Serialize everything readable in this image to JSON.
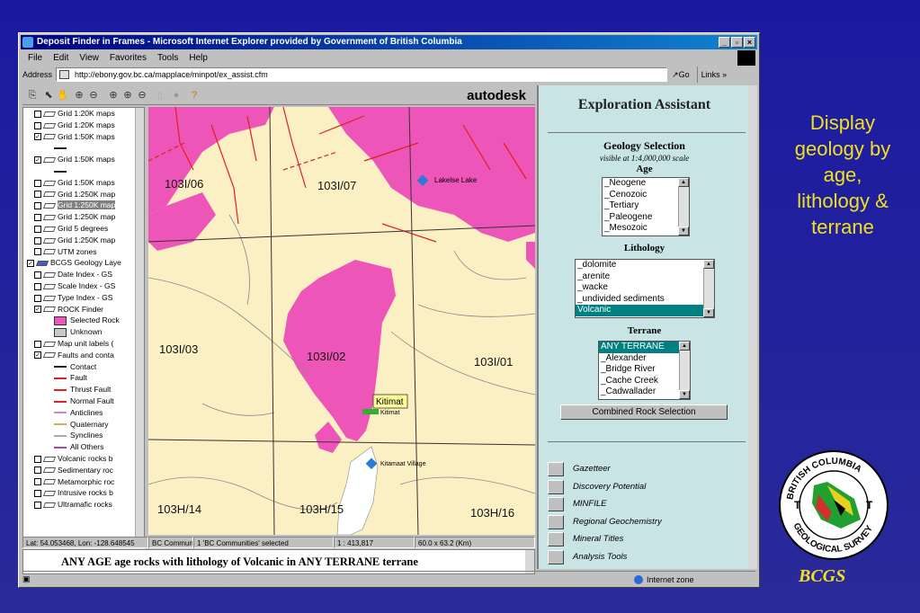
{
  "window": {
    "title": "Deposit Finder in Frames - Microsoft Internet Explorer provided by Government of British Columbia",
    "controls": [
      "_",
      "▫",
      "×"
    ]
  },
  "menu": [
    "File",
    "Edit",
    "View",
    "Favorites",
    "Tools",
    "Help"
  ],
  "address": {
    "label": "Address",
    "url": "http://ebony.gov.bc.ca/mapplace/minpot/ex_assist.cfm",
    "go": "Go",
    "links": "Links »"
  },
  "map_toolbar": {
    "brand": "autodesk"
  },
  "layers": [
    {
      "label": "Grid 1:20K maps",
      "check": "",
      "type": "layer"
    },
    {
      "label": "Grid 1:20K maps",
      "check": "",
      "type": "layer"
    },
    {
      "label": "Grid 1:50K maps",
      "check": "✓",
      "type": "layer"
    },
    {
      "label": "",
      "check": "",
      "type": "blank"
    },
    {
      "label": "Grid 1:50K maps",
      "check": "✓",
      "type": "layer"
    },
    {
      "label": "",
      "check": "",
      "type": "blank"
    },
    {
      "label": "Grid 1:50K maps",
      "check": "",
      "type": "layer"
    },
    {
      "label": "Grid 1:250K map",
      "check": "",
      "type": "layer"
    },
    {
      "label": "Grid 1:250K map",
      "check": "",
      "type": "layer",
      "highlight": true
    },
    {
      "label": "Grid 1:250K map",
      "check": "",
      "type": "layer"
    },
    {
      "label": "Grid 5 degrees",
      "check": "",
      "type": "layer"
    },
    {
      "label": "Grid 1:250K map",
      "check": "",
      "type": "layer"
    },
    {
      "label": "UTM zones",
      "check": "",
      "type": "layer"
    },
    {
      "label": "BCGS Geology Laye",
      "check": "✓",
      "type": "group"
    },
    {
      "label": "Date Index - GS",
      "check": "",
      "type": "layer"
    },
    {
      "label": "Scale Index - GS",
      "check": "",
      "type": "layer"
    },
    {
      "label": "Type Index - GS",
      "check": "",
      "type": "layer"
    },
    {
      "label": "ROCK Finder",
      "check": "✓",
      "type": "layer"
    },
    {
      "label": "Selected Rock",
      "type": "swatch",
      "color": "#ee55b8"
    },
    {
      "label": "Unknown",
      "type": "swatch",
      "color": "#c8c8c8"
    },
    {
      "label": "Map unit labels (",
      "check": "",
      "type": "layer"
    },
    {
      "label": "Faults and conta",
      "check": "✓",
      "type": "layer"
    },
    {
      "label": "Contact",
      "type": "line",
      "color": "#222222"
    },
    {
      "label": "Fault",
      "type": "line",
      "color": "#dd2222"
    },
    {
      "label": "Thrust Fault",
      "type": "line",
      "color": "#dd2222"
    },
    {
      "label": "Normal Fault",
      "type": "line",
      "color": "#dd2222"
    },
    {
      "label": "Anticlines",
      "type": "line",
      "color": "#cc88cc"
    },
    {
      "label": "Quaternary",
      "type": "line",
      "color": "#c8b060"
    },
    {
      "label": "Synclines",
      "type": "line",
      "color": "#aaaaaa"
    },
    {
      "label": "All Others",
      "type": "line",
      "color": "#aa44aa"
    },
    {
      "label": "Volcanic rocks b",
      "check": "",
      "type": "layer"
    },
    {
      "label": "Sedimentary roc",
      "check": "",
      "type": "layer"
    },
    {
      "label": "Metamorphic roc",
      "check": "",
      "type": "layer"
    },
    {
      "label": "Intrusive rocks b",
      "check": "",
      "type": "layer"
    },
    {
      "label": "Ultramafic rocks",
      "check": "",
      "type": "layer"
    }
  ],
  "map": {
    "tiles": [
      "103I/06",
      "103I/07",
      "103I/03",
      "103I/02",
      "103I/01",
      "103H/14",
      "103H/15",
      "103H/16"
    ],
    "places": [
      "Lakelse Lake",
      "Kitimat",
      "Kitimat",
      "Kitamaat Village"
    ]
  },
  "status": {
    "coords": "Lat: 54.053468, Lon: -128.648545",
    "layer": "BC Commun",
    "selected": "1 'BC Communities' selected",
    "scale": "1 : 413,817",
    "extent": "60.0 x 63.2 (Km)"
  },
  "result_text": "ANY AGE age rocks with lithology of Volcanic in ANY TERRANE terrane",
  "assistant": {
    "title": "Exploration Assistant",
    "geology_title": "Geology Selection",
    "geology_sub": "visible at 1:4,000,000 scale",
    "age_label": "Age",
    "age_options": [
      "_Neogene",
      "_Cenozoic",
      "_Tertiary",
      "_Paleogene",
      "_Mesozoic"
    ],
    "lithology_label": "Lithology",
    "lithology_options": [
      "_dolomite",
      "_arenite",
      "_wacke",
      "_undivided sediments",
      "Volcanic"
    ],
    "lithology_selected": 4,
    "terrane_label": "Terrane",
    "terrane_options": [
      "ANY TERRANE",
      "_Alexander",
      "_Bridge River",
      "_Cache Creek",
      "_Cadwallader"
    ],
    "terrane_selected": 0,
    "combined_button": "Combined Rock Selection",
    "nav": [
      "Gazetteer",
      "Discovery Potential",
      "MINFILE",
      "Regional Geochemistry",
      "Mineral Titles",
      "Analysis Tools"
    ]
  },
  "statusbar": {
    "zone": "Internet zone"
  },
  "slide": {
    "caption": [
      "Display",
      "geology by",
      "age,",
      "lithology &",
      "terrane"
    ],
    "logo_text": [
      "BRITISH COLUMBIA",
      "GEOLOGICAL SURVEY"
    ],
    "footer": "BCGS"
  },
  "colors": {
    "accent_yellow": "#f0e020",
    "slide_blue": "#22229a",
    "selected_rock": "#ee55b8",
    "map_base": "#fbf0c4"
  }
}
